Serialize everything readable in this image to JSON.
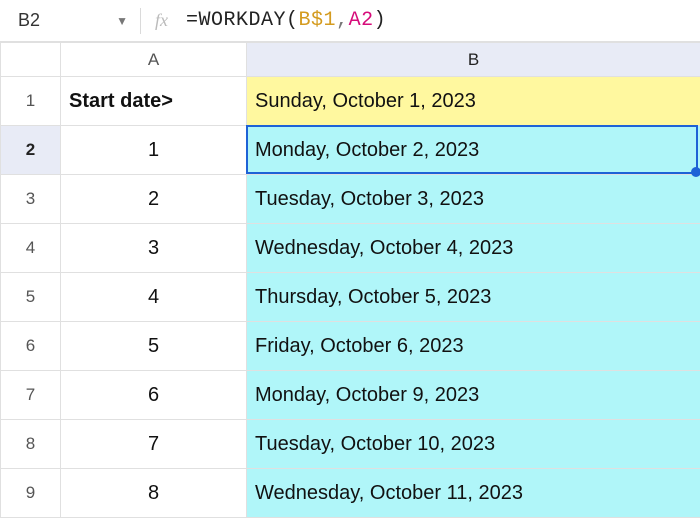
{
  "formulaBar": {
    "cellRef": "B2",
    "fxLabel": "fx",
    "formula": {
      "prefix": "=",
      "fn": "WORKDAY",
      "open": "(",
      "arg1": "B$1",
      "comma": ",",
      "arg2": "A2",
      "close": ")"
    }
  },
  "columns": {
    "A": "A",
    "B": "B"
  },
  "rows": [
    {
      "n": "1",
      "a": "Start date>",
      "b": "Sunday, October 1, 2023",
      "aClass": "label-bold",
      "bClass": "bg-yellow"
    },
    {
      "n": "2",
      "a": "1",
      "b": "Monday, October 2, 2023",
      "aClass": "centered",
      "bClass": "bg-cyan",
      "selected": true
    },
    {
      "n": "3",
      "a": "2",
      "b": "Tuesday, October 3, 2023",
      "aClass": "centered",
      "bClass": "bg-cyan"
    },
    {
      "n": "4",
      "a": "3",
      "b": "Wednesday, October 4, 2023",
      "aClass": "centered",
      "bClass": "bg-cyan"
    },
    {
      "n": "5",
      "a": "4",
      "b": "Thursday, October 5, 2023",
      "aClass": "centered",
      "bClass": "bg-cyan"
    },
    {
      "n": "6",
      "a": "5",
      "b": "Friday, October 6, 2023",
      "aClass": "centered",
      "bClass": "bg-cyan"
    },
    {
      "n": "7",
      "a": "6",
      "b": "Monday, October 9, 2023",
      "aClass": "centered",
      "bClass": "bg-cyan"
    },
    {
      "n": "8",
      "a": "7",
      "b": "Tuesday, October 10, 2023",
      "aClass": "centered",
      "bClass": "bg-cyan"
    },
    {
      "n": "9",
      "a": "8",
      "b": "Wednesday, October 11, 2023",
      "aClass": "centered",
      "bClass": "bg-cyan"
    }
  ]
}
